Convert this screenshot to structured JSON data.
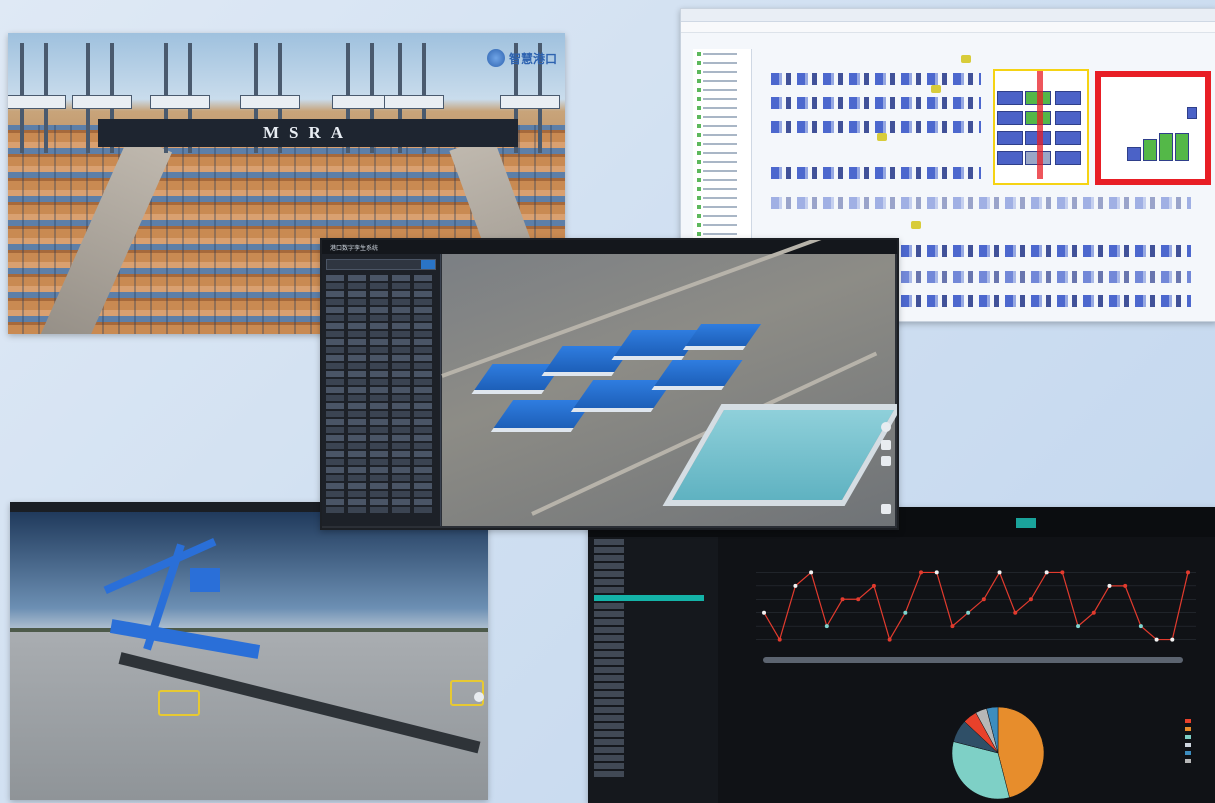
{
  "port": {
    "banner": "MSRA",
    "logo_text": "智慧港口"
  },
  "gis": {
    "title": "港口数字孪生系统"
  },
  "dashboard": {
    "legend_colors": [
      "#e8412b",
      "#e78d2c",
      "#7ed0c6",
      "#cfd6df",
      "#3d8dbf",
      "#b7b7b7"
    ]
  },
  "chart_data": [
    {
      "type": "line",
      "series": [
        {
          "values": [
            3,
            1,
            5,
            6,
            2,
            4,
            4,
            5,
            1,
            3,
            6,
            6,
            2,
            3,
            4,
            6,
            3,
            4,
            6,
            6,
            2,
            3,
            5,
            5,
            2,
            1,
            1,
            6
          ],
          "point_colors": [
            "w",
            "r",
            "w",
            "w",
            "c",
            "r",
            "r",
            "r",
            "r",
            "c",
            "r",
            "w",
            "r",
            "c",
            "r",
            "w",
            "r",
            "r",
            "w",
            "r",
            "c",
            "r",
            "w",
            "r",
            "c",
            "w",
            "w",
            "r"
          ]
        }
      ],
      "colors": {
        "line": "#e23b2e",
        "point": "#f2f2f2",
        "point_alt": "#7fd5d0"
      },
      "ylim": [
        0,
        7
      ],
      "grid": true
    },
    {
      "type": "pie",
      "values": [
        46,
        33,
        8,
        5,
        4,
        4
      ],
      "colors": [
        "#e78d2c",
        "#7ed0c6",
        "#2f4f67",
        "#e8412b",
        "#b7b7b7",
        "#3d8dbf"
      ]
    }
  ]
}
